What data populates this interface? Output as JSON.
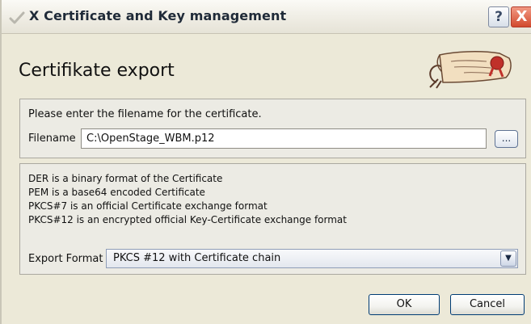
{
  "window": {
    "title": "X Certificate and Key management",
    "help_label": "?",
    "close_label": "X"
  },
  "header": {
    "title": "Certifikate export",
    "logo_icon": "scroll-logo-icon"
  },
  "filename_group": {
    "instruction": "Please enter the filename for the certificate.",
    "filename_label": "Filename",
    "filename_value": "C:\\OpenStage_WBM.p12",
    "browse_label": "..."
  },
  "format_group": {
    "descriptions": [
      "DER is a binary format of the Certificate",
      "PEM is a base64 encoded Certificate",
      "PKCS#7 is an official Certificate exchange format",
      "PKCS#12 is an encrypted official Key-Certificate exchange format"
    ],
    "export_format_label": "Export Format",
    "export_format_value": "PKCS #12 with Certificate chain"
  },
  "buttons": {
    "ok": "OK",
    "cancel": "Cancel"
  },
  "colors": {
    "dialog_bg": "#ece9d8",
    "group_bg": "#ecebe4",
    "close_button": "#d24a2e"
  }
}
